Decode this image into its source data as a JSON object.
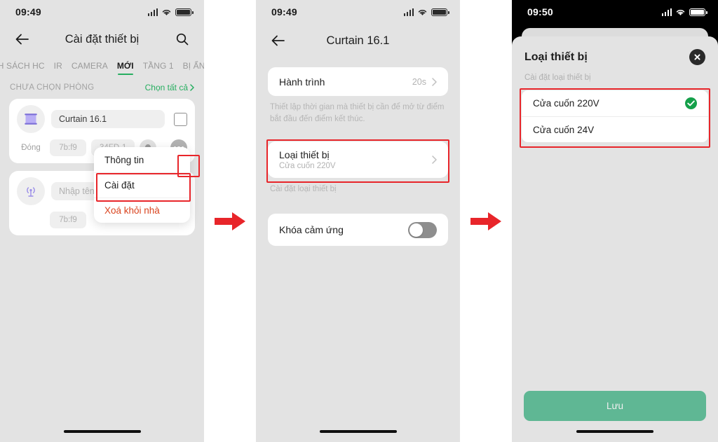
{
  "screens": [
    {
      "id": "device-list",
      "status": {
        "time": "09:49",
        "signal": "signal-icon",
        "wifi": "wifi-icon",
        "battery": "battery-icon"
      },
      "nav": {
        "back": "back-arrow-icon",
        "title": "Cài đặt thiết bị",
        "search": "search-icon"
      },
      "tabs": [
        {
          "label": "NH SÁCH HC",
          "active": false
        },
        {
          "label": "IR",
          "active": false
        },
        {
          "label": "CAMERA",
          "active": false
        },
        {
          "label": "MỚI",
          "active": true
        },
        {
          "label": "TẦNG 1",
          "active": false
        },
        {
          "label": "BỊ ẨN",
          "active": false
        }
      ],
      "section": {
        "label": "CHƯA CHỌN PHÒNG",
        "action": "Chọn tất cả",
        "chevron": "chevron-right-icon"
      },
      "cards": [
        {
          "icon": "curtain-icon",
          "name": "Curtain 16.1",
          "state": "Đóng",
          "pill1": "7b:f9",
          "pill2": "34FD-1",
          "bulb": "bulb-icon",
          "more": "more-dots-icon"
        },
        {
          "icon": "wifi-device-icon",
          "name_placeholder": "Nhập tên",
          "pill1": "7b:f9"
        }
      ],
      "context_menu": [
        {
          "label": "Thông tin",
          "danger": false,
          "highlighted": false
        },
        {
          "label": "Cài đặt",
          "danger": false,
          "highlighted": true
        },
        {
          "label": "Xoá khỏi nhà",
          "danger": true,
          "highlighted": false
        }
      ]
    },
    {
      "id": "device-settings",
      "status": {
        "time": "09:49"
      },
      "nav": {
        "back": "back-arrow-icon",
        "title": "Curtain 16.1"
      },
      "rows": [
        {
          "title": "Hành trình",
          "value": "20s",
          "chevron": "chevron-right-icon"
        }
      ],
      "helper_1": "Thiết lập thời gian mà thiết bị cần để mở từ điểm bắt đầu đến điểm kết thúc.",
      "device_type_row": {
        "title": "Loại thiết bị",
        "subtitle": "Cửa cuốn 220V",
        "chevron": "chevron-right-icon",
        "highlighted": true
      },
      "helper_2": "Cài đặt loại thiết bị",
      "toggle_row": {
        "title": "Khóa cảm ứng",
        "state": "off"
      }
    },
    {
      "id": "device-type-sheet",
      "status": {
        "time": "09:50"
      },
      "sheet": {
        "title": "Loại thiết bị",
        "close": "close-icon",
        "subtitle": "Cài đặt loại thiết bị",
        "options": [
          {
            "label": "Cửa cuốn 220V",
            "selected": true,
            "check": "check-circle-icon"
          },
          {
            "label": "Cửa cuốn 24V",
            "selected": false
          }
        ],
        "save_label": "Lưu"
      }
    }
  ],
  "flow_arrows": [
    {
      "name": "flow-arrow-1"
    },
    {
      "name": "flow-arrow-2"
    }
  ],
  "colors": {
    "accent_green": "#27ae60",
    "highlight_red": "#e8252a",
    "save_button": "#5fb794",
    "check_green": "#14a04a",
    "danger_text": "#d9441f",
    "page_bg": "#e3e3e3"
  }
}
